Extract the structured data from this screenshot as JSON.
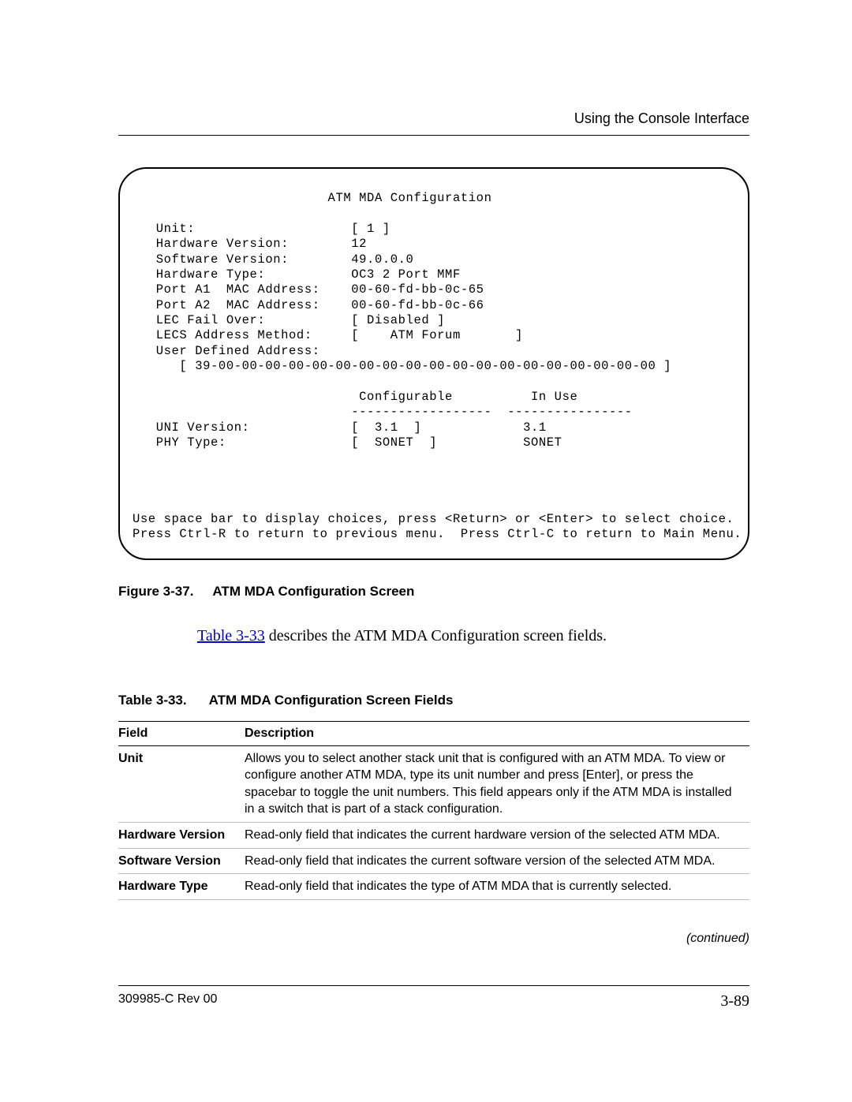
{
  "header": {
    "section": "Using the Console Interface"
  },
  "console": {
    "text": "                         ATM MDA Configuration\n\n   Unit:                    [ 1 ]\n   Hardware Version:        12\n   Software Version:        49.0.0.0\n   Hardware Type:           OC3 2 Port MMF\n   Port A1  MAC Address:    00-60-fd-bb-0c-65\n   Port A2  MAC Address:    00-60-fd-bb-0c-66\n   LEC Fail Over:           [ Disabled ]\n   LECS Address Method:     [    ATM Forum       ]\n   User Defined Address:\n      [ 39-00-00-00-00-00-00-00-00-00-00-00-00-00-00-00-00-00-00-00 ]\n\n                             Configurable          In Use\n                            ------------------  ----------------\n   UNI Version:             [  3.1  ]             3.1\n   PHY Type:                [  SONET  ]           SONET\n\n\n\n\nUse space bar to display choices, press <Return> or <Enter> to select choice.\nPress Ctrl-R to return to previous menu.  Press Ctrl-C to return to Main Menu."
  },
  "figure": {
    "number": "Figure 3-37.",
    "title": "ATM MDA Configuration Screen"
  },
  "midtext": {
    "link": "Table 3-33",
    "rest": " describes the ATM MDA Configuration screen fields."
  },
  "table": {
    "number": "Table 3-33.",
    "title": "ATM MDA Configuration Screen Fields",
    "head_field": "Field",
    "head_desc": "Description",
    "rows": [
      {
        "field": "Unit",
        "desc": "Allows you to select another stack unit that is configured with an ATM MDA. To view or configure another ATM MDA, type its unit number and press [Enter], or press the spacebar to toggle the unit numbers. This field appears only if the ATM MDA is installed in a switch that is part of a stack configuration."
      },
      {
        "field": "Hardware Version",
        "desc": "Read-only field that indicates the current hardware version of the selected ATM MDA."
      },
      {
        "field": "Software Version",
        "desc": "Read-only field that indicates the current software version of the selected ATM MDA."
      },
      {
        "field": "Hardware Type",
        "desc": "Read-only field that indicates the type of ATM MDA that is currently selected."
      }
    ]
  },
  "continued": "(continued)",
  "footer": {
    "left": "309985-C Rev 00",
    "right": "3-89"
  }
}
